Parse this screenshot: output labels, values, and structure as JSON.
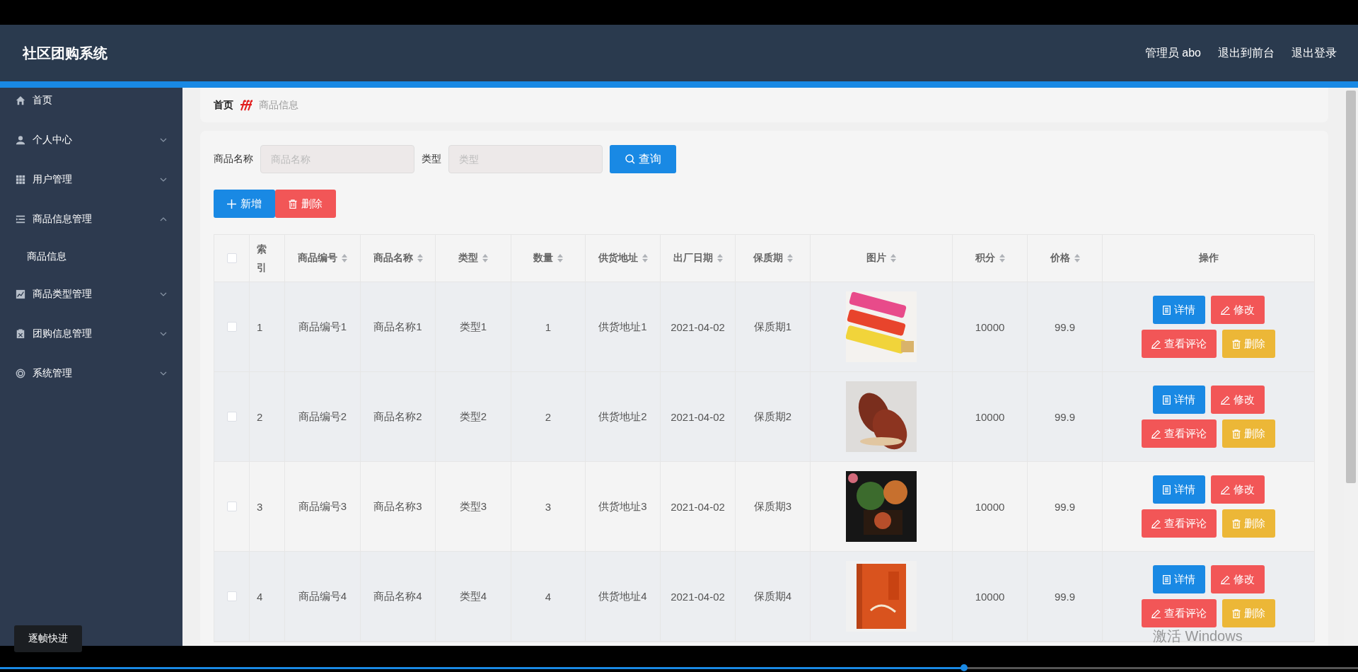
{
  "header": {
    "title": "社区团购系统",
    "links": [
      "管理员 abo",
      "退出到前台",
      "退出登录"
    ]
  },
  "sidebar": {
    "items": [
      {
        "label": "首页",
        "kind": "link"
      },
      {
        "label": "个人中心",
        "kind": "menu",
        "expanded": false
      },
      {
        "label": "用户管理",
        "kind": "menu",
        "expanded": false
      },
      {
        "label": "商品信息管理",
        "kind": "menu",
        "expanded": true,
        "children": [
          {
            "label": "商品信息"
          }
        ]
      },
      {
        "label": "商品类型管理",
        "kind": "menu",
        "expanded": false
      },
      {
        "label": "团购信息管理",
        "kind": "menu",
        "expanded": false
      },
      {
        "label": "系统管理",
        "kind": "menu",
        "expanded": false
      }
    ]
  },
  "breadcrumb": [
    "首页",
    "商品信息"
  ],
  "search": {
    "fields": [
      {
        "label": "商品名称",
        "placeholder": "商品名称"
      },
      {
        "label": "类型",
        "placeholder": "类型"
      }
    ],
    "button": "查询"
  },
  "actions": [
    {
      "label": "新增",
      "kind": "add"
    },
    {
      "label": "删除",
      "kind": "delete"
    }
  ],
  "table": {
    "select_all": {
      "checked": false
    },
    "columns": [
      {
        "label": "索引",
        "sortable": false
      },
      {
        "label": "商品编号",
        "sortable": true
      },
      {
        "label": "商品名称",
        "sortable": true
      },
      {
        "label": "类型",
        "sortable": true
      },
      {
        "label": "数量",
        "sortable": true
      },
      {
        "label": "供货地址",
        "sortable": true
      },
      {
        "label": "出厂日期",
        "sortable": true
      },
      {
        "label": "保质期",
        "sortable": true
      },
      {
        "label": "图片",
        "sortable": true
      },
      {
        "label": "积分",
        "sortable": true
      },
      {
        "label": "价格",
        "sortable": true
      },
      {
        "label": "操作",
        "sortable": false
      }
    ],
    "rows": [
      {
        "checked": false,
        "cells": [
          "1",
          "商品编号1",
          "商品名称1",
          "类型1",
          "1",
          "供货地址1",
          "2021-04-02",
          "保质期1"
        ],
        "points": "10000",
        "price": "99.9",
        "buttons": [
          {
            "label": "详情",
            "kind": "detail"
          },
          {
            "label": "修改",
            "kind": "edit"
          },
          {
            "label": "查看评论",
            "kind": "comment"
          },
          {
            "label": "删除",
            "kind": "delete"
          }
        ]
      },
      {
        "checked": false,
        "cells": [
          "2",
          "商品编号2",
          "商品名称2",
          "类型2",
          "2",
          "供货地址2",
          "2021-04-02",
          "保质期2"
        ],
        "points": "10000",
        "price": "99.9",
        "buttons": [
          {
            "label": "详情",
            "kind": "detail"
          },
          {
            "label": "修改",
            "kind": "edit"
          },
          {
            "label": "查看评论",
            "kind": "comment"
          },
          {
            "label": "删除",
            "kind": "delete"
          }
        ]
      },
      {
        "checked": false,
        "cells": [
          "3",
          "商品编号3",
          "商品名称3",
          "类型3",
          "3",
          "供货地址3",
          "2021-04-02",
          "保质期3"
        ],
        "points": "10000",
        "price": "99.9",
        "buttons": [
          {
            "label": "详情",
            "kind": "detail"
          },
          {
            "label": "修改",
            "kind": "edit"
          },
          {
            "label": "查看评论",
            "kind": "comment"
          },
          {
            "label": "删除",
            "kind": "delete"
          }
        ]
      },
      {
        "checked": false,
        "cells": [
          "4",
          "商品编号4",
          "商品名称4",
          "类型4",
          "4",
          "供货地址4",
          "2021-04-02",
          "保质期4"
        ],
        "points": "10000",
        "price": "99.9",
        "buttons": [
          {
            "label": "详情",
            "kind": "detail"
          },
          {
            "label": "修改",
            "kind": "edit"
          },
          {
            "label": "查看评论",
            "kind": "comment"
          },
          {
            "label": "删除",
            "kind": "delete"
          }
        ]
      }
    ]
  },
  "player": {
    "overlay_button": "逐帧快进",
    "os_notice": "激活 Windows",
    "progress": {
      "level": 0.71
    }
  }
}
